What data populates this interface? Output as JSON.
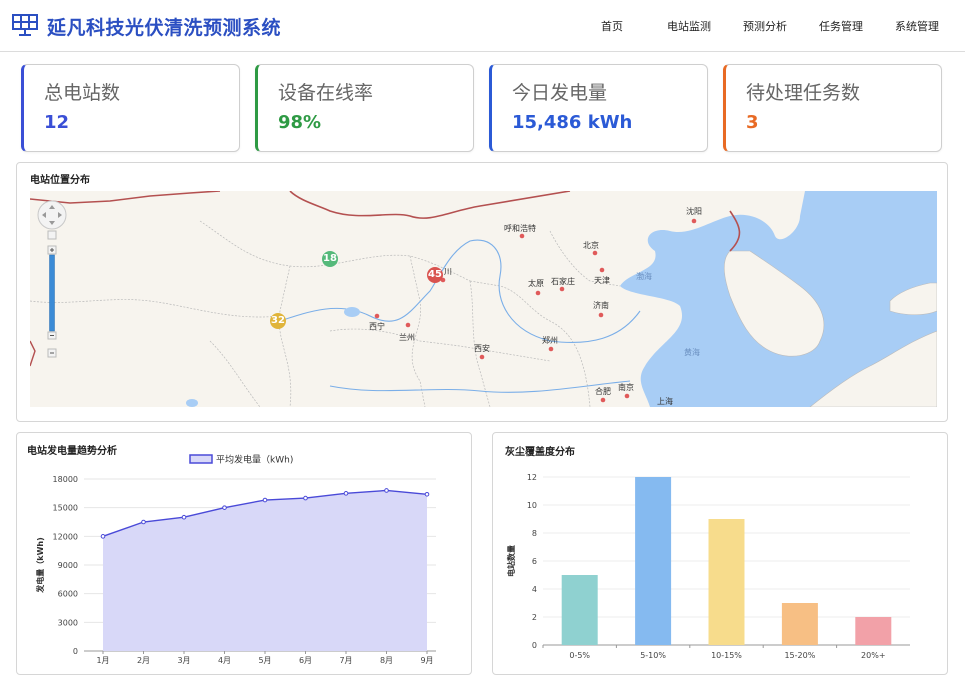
{
  "header": {
    "title": "延凡科技光伏清洗预测系统",
    "nav": [
      "首页",
      "电站监测",
      "预测分析",
      "任务管理",
      "系统管理"
    ]
  },
  "cards": [
    {
      "label": "总电站数",
      "value": "12",
      "color": "#3a4fd6"
    },
    {
      "label": "设备在线率",
      "value": "98%",
      "color": "#2e9a44"
    },
    {
      "label": "今日发电量",
      "value": "15,486 kWh",
      "color": "#2b5ad6"
    },
    {
      "label": "待处理任务数",
      "value": "3",
      "color": "#e86a24"
    }
  ],
  "map_panel": {
    "title": "电站位置分布",
    "clusters": [
      {
        "count": "18",
        "color": "#55b97a"
      },
      {
        "count": "45",
        "color": "#d9534f"
      },
      {
        "count": "32",
        "color": "#e0b43a"
      }
    ],
    "cities": [
      "呼和浩特",
      "沈阳",
      "北京",
      "天津",
      "石家庄",
      "太原",
      "济南",
      "郑州",
      "西安",
      "兰州",
      "西宁",
      "合肥",
      "南京",
      "上海",
      "川"
    ],
    "seas": [
      "渤海",
      "黄海"
    ]
  },
  "chart_data": [
    {
      "type": "area",
      "title": "电站发电量趋势分析",
      "legend": "平均发电量（kWh)",
      "ylabel": "发电量（kWh)",
      "categories": [
        "1月",
        "2月",
        "3月",
        "4月",
        "5月",
        "6月",
        "7月",
        "8月",
        "9月"
      ],
      "values": [
        12000,
        13500,
        14000,
        15000,
        15800,
        16000,
        16500,
        16800,
        16400
      ],
      "ylim": [
        0,
        18000
      ],
      "yticks": [
        0,
        3000,
        6000,
        9000,
        12000,
        15000,
        18000
      ],
      "color": "#4a4ad8",
      "fill": "#d8d8f8"
    },
    {
      "type": "bar",
      "title": "灰尘覆盖度分布",
      "ylabel": "电站数量",
      "categories": [
        "0-5%",
        "5-10%",
        "10-15%",
        "15-20%",
        "20%+"
      ],
      "values": [
        5,
        12,
        9,
        3,
        2
      ],
      "ylim": [
        0,
        12
      ],
      "yticks": [
        0,
        2,
        4,
        6,
        8,
        10,
        12
      ],
      "colors": [
        "#8fd1d0",
        "#85baf0",
        "#f7dc8c",
        "#f7bf84",
        "#f2a1a8"
      ]
    }
  ]
}
